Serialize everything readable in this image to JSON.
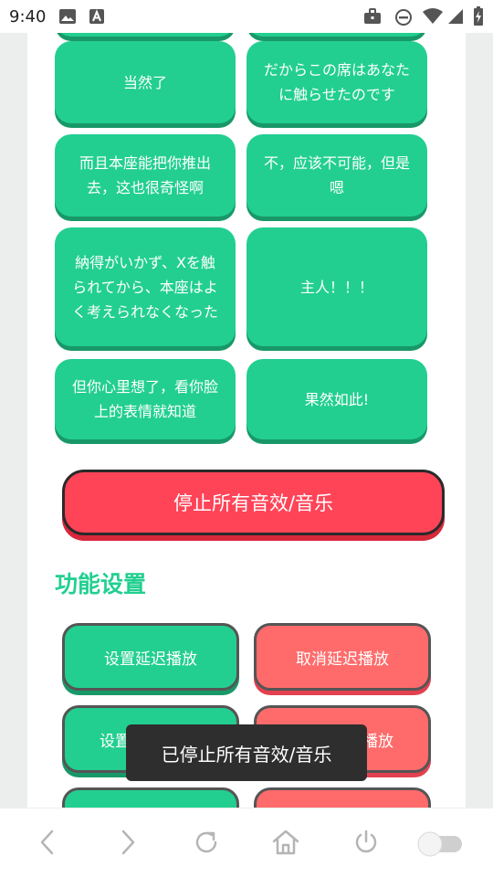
{
  "status_bar": {
    "time": "9:40",
    "left_icons": [
      "image-icon",
      "font-a-icon"
    ],
    "right_icons": [
      "briefcase-icon",
      "do-not-disturb-icon",
      "wifi-icon",
      "signal-icon",
      "battery-charging-icon"
    ]
  },
  "phrase_buttons": [
    {
      "label": "当然了"
    },
    {
      "label": "だからこの席はあなたに触らせたのです"
    },
    {
      "label": "而且本座能把你推出去，这也很奇怪啊"
    },
    {
      "label": "不，应该不可能，但是嗯"
    },
    {
      "label": "納得がいかず、Xを触られてから、本座はよく考えられなくなった"
    },
    {
      "label": "主人！！！"
    },
    {
      "label": "但你心里想了，看你脸上的表情就知道"
    },
    {
      "label": "果然如此!"
    }
  ],
  "stop_all_label": "停止所有音效/音乐",
  "settings_section": {
    "title": "功能设置",
    "buttons": [
      {
        "label": "设置延迟播放"
      },
      {
        "label": "取消延迟播放"
      },
      {
        "label": "设置"
      },
      {
        "label": "播放"
      }
    ]
  },
  "toast": "已停止所有音效/音乐",
  "bottom_nav": [
    "back-icon",
    "forward-icon",
    "reload-icon",
    "home-icon",
    "power-icon",
    "toggle-switch"
  ],
  "colors": {
    "green": "#22cf91",
    "green_shadow": "#189868",
    "red": "#ff4458",
    "coral": "#ff6b6b"
  }
}
